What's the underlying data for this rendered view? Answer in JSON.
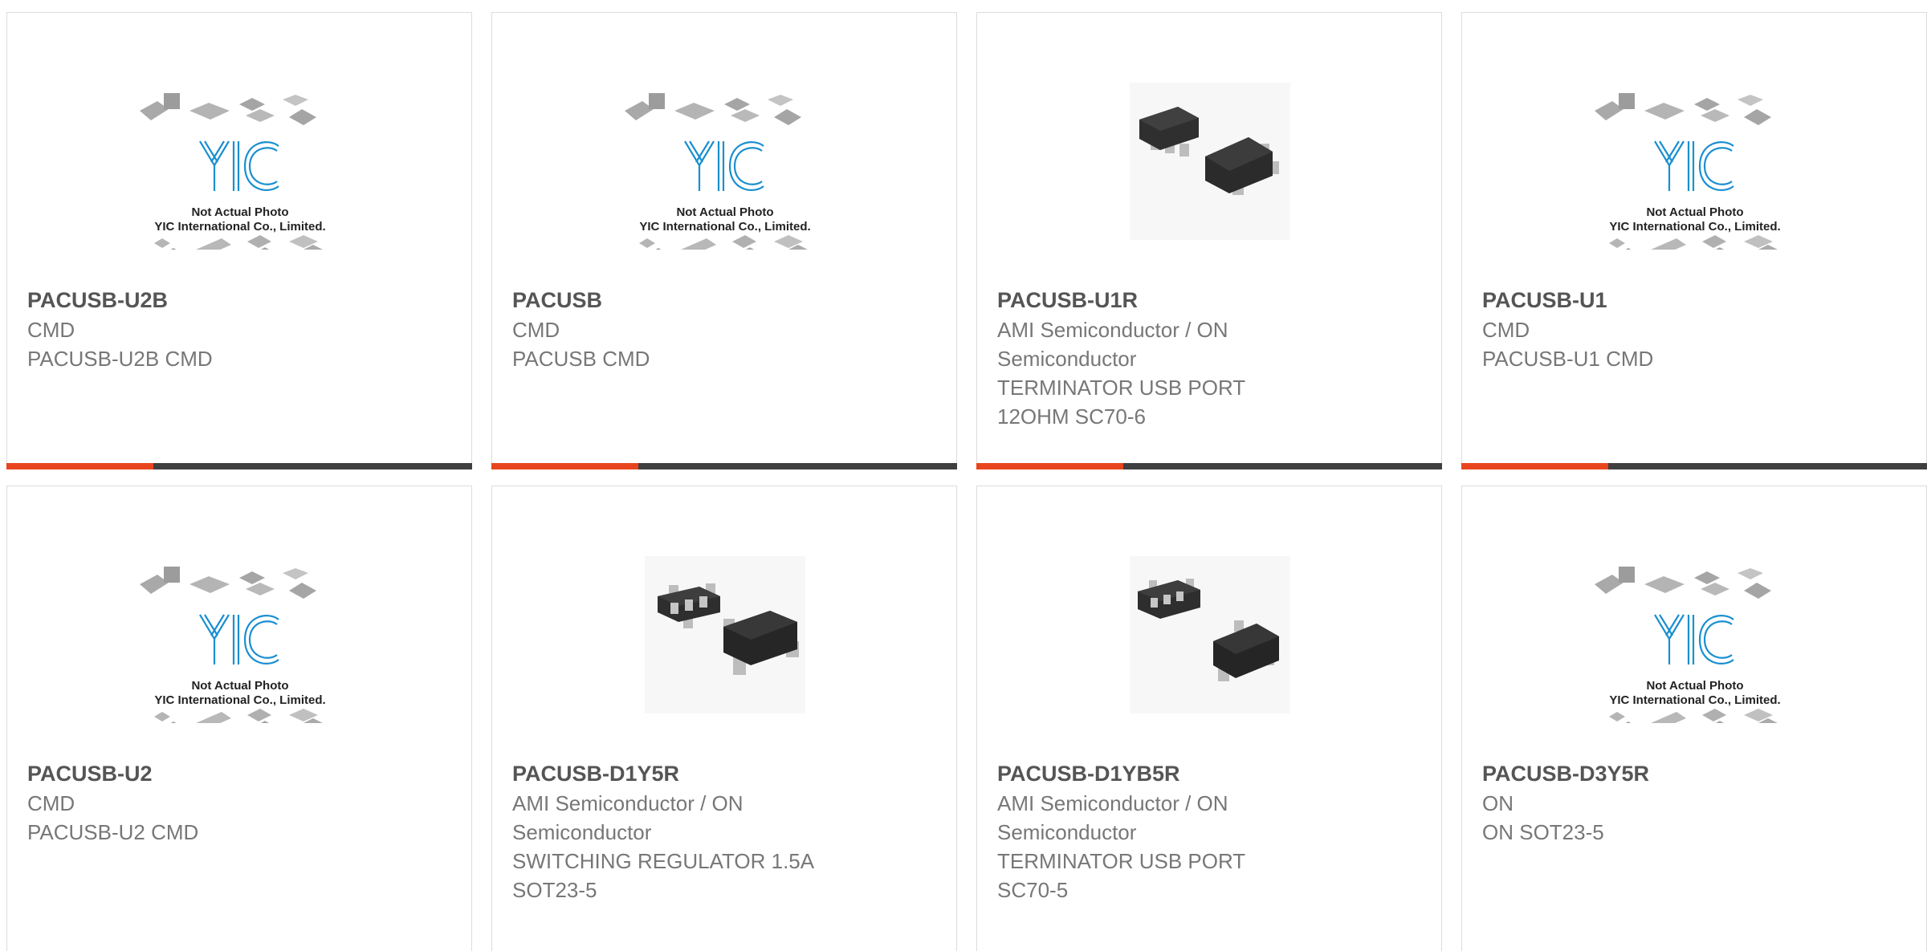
{
  "theme": {
    "accent": "#e8451e",
    "bar": "#3f3f3f",
    "logo_blue": "#1a8fd0"
  },
  "placeholder_image": {
    "line1": "Not Actual Photo",
    "line2": "YIC International Co., Limited."
  },
  "products": [
    {
      "part": "PACUSB-U2B",
      "lines": [
        "CMD",
        "PACUSB-U2B CMD"
      ],
      "image": "placeholder"
    },
    {
      "part": "PACUSB",
      "lines": [
        "CMD",
        "PACUSB CMD"
      ],
      "image": "placeholder"
    },
    {
      "part": "PACUSB-U1R",
      "lines": [
        "AMI Semiconductor / ON",
        "Semiconductor",
        "TERMINATOR USB PORT",
        "12OHM SC70-6"
      ],
      "image": "sc70-6-chip-photo"
    },
    {
      "part": "PACUSB-U1",
      "lines": [
        "CMD",
        "PACUSB-U1 CMD"
      ],
      "image": "placeholder"
    },
    {
      "part": "PACUSB-U2",
      "lines": [
        "CMD",
        "PACUSB-U2 CMD"
      ],
      "image": "placeholder"
    },
    {
      "part": "PACUSB-D1Y5R",
      "lines": [
        "AMI Semiconductor / ON",
        "Semiconductor",
        "SWITCHING REGULATOR 1.5A",
        "SOT23-5"
      ],
      "image": "sot23-5-chip-photo"
    },
    {
      "part": "PACUSB-D1YB5R",
      "lines": [
        "AMI Semiconductor / ON",
        "Semiconductor",
        "TERMINATOR USB PORT",
        "SC70-5"
      ],
      "image": "sc70-5-chip-photo"
    },
    {
      "part": "PACUSB-D3Y5R",
      "lines": [
        "ON",
        "ON SOT23-5"
      ],
      "image": "placeholder"
    }
  ]
}
